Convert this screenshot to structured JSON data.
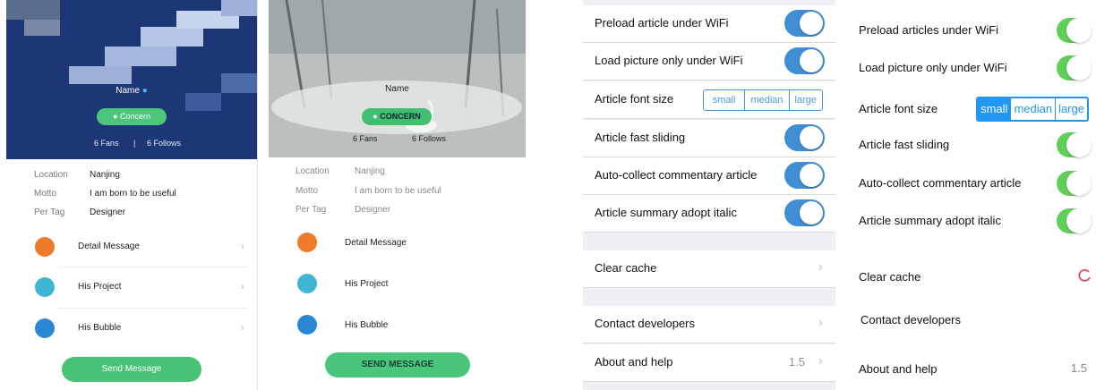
{
  "profile_a": {
    "name": "Name",
    "concern": "Concern",
    "fans": "6 Fans",
    "divider": "|",
    "follows": "6 Follows",
    "info": [
      {
        "key": "Location",
        "value": "Nanjing"
      },
      {
        "key": "Motto",
        "value": "I am born to be useful"
      },
      {
        "key": "Per Tag",
        "value": "Designer"
      }
    ],
    "menu": [
      {
        "label": "Detail Message",
        "icon": "document-icon",
        "color": "#ee7b2c"
      },
      {
        "label": "His Project",
        "icon": "layers-icon",
        "color": "#3fb6d4"
      },
      {
        "label": "His Bubble",
        "icon": "chat-bubble-icon",
        "color": "#2a87d4"
      }
    ],
    "send": "Send Message"
  },
  "profile_b": {
    "name": "Name",
    "concern": "CONCERN",
    "fans": "6 Fans",
    "follows": "6 Follows",
    "info": [
      {
        "key": "Location",
        "value": "Nanjing"
      },
      {
        "key": "Motto",
        "value": "I am born to be useful"
      },
      {
        "key": "Per Tag",
        "value": "Designer"
      }
    ],
    "menu": [
      {
        "label": "Detail Message",
        "icon": "document-icon",
        "color": "#ee7b2c"
      },
      {
        "label": "His Project",
        "icon": "layers-icon",
        "color": "#3fb6d4"
      },
      {
        "label": "His Bubble",
        "icon": "chat-bubble-icon",
        "color": "#2a87d4"
      }
    ],
    "send": "SEND MESSAGE"
  },
  "ios_settings": {
    "preload": "Preload article under WiFi",
    "load_picture": "Load picture only under WiFi",
    "font_size": "Article font size",
    "font_options": [
      "small",
      "median",
      "large"
    ],
    "fast_sliding": "Article fast sliding",
    "auto_collect": "Auto-collect commentary article",
    "italic": "Article summary adopt italic",
    "clear_cache": "Clear cache",
    "contact": "Contact developers",
    "about": "About and help",
    "version": "1.5",
    "accent": "#3f8ed6"
  },
  "android_settings": {
    "preload": "Preload articles under WiFi",
    "load_picture": "Load picture only under WiFi",
    "font_size": "Article font size",
    "font_options": [
      "small",
      "median",
      "large"
    ],
    "selected_option": "small",
    "fast_sliding": "Article fast sliding",
    "auto_collect": "Auto-collect commentary article",
    "italic": "Article summary adopt italic",
    "clear_cache": "Clear cache",
    "contact": "Contact developers",
    "about": "About and help",
    "version": "1.5",
    "accent": "#5fcf5a"
  }
}
